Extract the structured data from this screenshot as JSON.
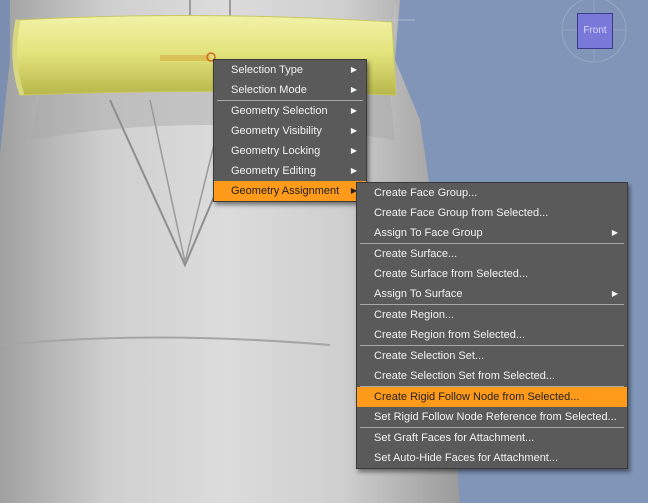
{
  "viewport": {
    "background": "#7d8fb0",
    "figure_color": "#bdbdbd",
    "belt_color": "#e6e68a",
    "cube_icon": "view-cube-icon",
    "cube_label": "Front"
  },
  "context_menu": {
    "items": [
      {
        "label": "Selection Type",
        "submenu": true
      },
      {
        "label": "Selection Mode",
        "submenu": true
      },
      {
        "label": "Geometry Selection",
        "submenu": true
      },
      {
        "label": "Geometry Visibility",
        "submenu": true
      },
      {
        "label": "Geometry Locking",
        "submenu": true
      },
      {
        "label": "Geometry Editing",
        "submenu": true
      },
      {
        "label": "Geometry Assignment",
        "submenu": true,
        "highlighted": true
      }
    ]
  },
  "submenu": {
    "items": [
      {
        "label": "Create Face Group..."
      },
      {
        "label": "Create Face Group from Selected..."
      },
      {
        "label": "Assign To Face Group",
        "submenu": true
      },
      {
        "label": "Create Surface..."
      },
      {
        "label": "Create Surface from Selected..."
      },
      {
        "label": "Assign To Surface",
        "submenu": true
      },
      {
        "label": "Create Region..."
      },
      {
        "label": "Create Region from Selected..."
      },
      {
        "label": "Create Selection Set..."
      },
      {
        "label": "Create Selection Set from Selected..."
      },
      {
        "label": "Create Rigid Follow Node from Selected...",
        "highlighted": true
      },
      {
        "label": "Set Rigid Follow Node Reference from Selected..."
      },
      {
        "label": "Set Graft Faces for Attachment..."
      },
      {
        "label": "Set Auto-Hide Faces for Attachment..."
      }
    ]
  },
  "highlight_color": "#ff9a1a",
  "arrow_glyph": "▶"
}
